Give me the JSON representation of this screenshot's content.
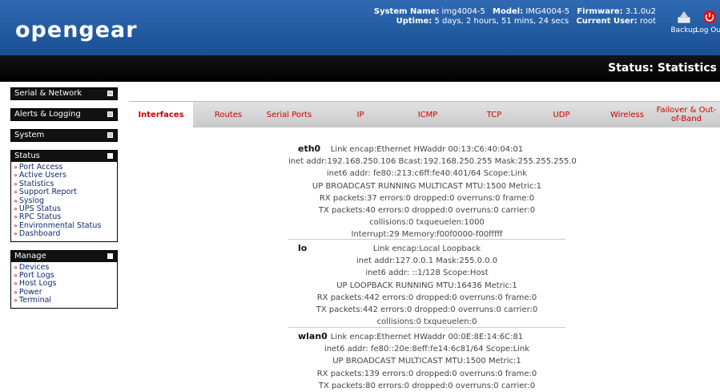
{
  "header": {
    "logo": "opengear",
    "system_name_label": "System Name:",
    "system_name": "img4004-5",
    "model_label": "Model:",
    "model": "IMG4004-5",
    "firmware_label": "Firmware:",
    "firmware": "3.1.0u2",
    "uptime_label": "Uptime:",
    "uptime": "5 days, 2 hours, 51 mins, 24 secs",
    "current_user_label": "Current User:",
    "current_user": "root",
    "backup_label": "Backup",
    "logout_label": "Log Out"
  },
  "page_title": "Status: Statistics",
  "sidebar": {
    "serial_network": "Serial & Network",
    "alerts_logging": "Alerts & Logging",
    "system": "System",
    "status": {
      "title": "Status",
      "items": [
        "Port Access",
        "Active Users",
        "Statistics",
        "Support Report",
        "Syslog",
        "UPS Status",
        "RPC Status",
        "Environmental Status",
        "Dashboard"
      ]
    },
    "manage": {
      "title": "Manage",
      "items": [
        "Devices",
        "Port Logs",
        "Host Logs",
        "Power",
        "Terminal"
      ]
    }
  },
  "tabs": [
    "Interfaces",
    "Routes",
    "Serial Ports",
    "IP",
    "ICMP",
    "TCP",
    "UDP",
    "Wireless",
    "Failover & Out-of-Band"
  ],
  "interfaces": [
    {
      "name": "eth0",
      "lines": [
        "Link encap:Ethernet HWaddr 00:13:C6:40:04:01",
        "inet addr:192.168.250.106 Bcast:192.168.250.255 Mask:255.255.255.0",
        "inet6 addr: fe80::213:c6ff:fe40:401/64 Scope:Link",
        "UP BROADCAST RUNNING MULTICAST MTU:1500 Metric:1",
        "RX packets:37 errors:0 dropped:0 overruns:0 frame:0",
        "TX packets:40 errors:0 dropped:0 overruns:0 carrier:0",
        "collisions:0 txqueuelen:1000",
        "Interrupt:29 Memory:f00f0000-f00fffff"
      ]
    },
    {
      "name": "lo",
      "lines": [
        "Link encap:Local Loopback",
        "inet addr:127.0.0.1 Mask:255.0.0.0",
        "inet6 addr: ::1/128 Scope:Host",
        "UP LOOPBACK RUNNING MTU:16436 Metric:1",
        "RX packets:442 errors:0 dropped:0 overruns:0 frame:0",
        "TX packets:442 errors:0 dropped:0 overruns:0 carrier:0",
        "collisions:0 txqueuelen:0"
      ]
    },
    {
      "name": "wlan0",
      "lines": [
        "Link encap:Ethernet HWaddr 00:0E:8E:14:6C:81",
        "inet6 addr: fe80::20e:8eff:fe14:6c81/64 Scope:Link",
        "UP BROADCAST MULTICAST MTU:1500 Metric:1",
        "RX packets:139 errors:0 dropped:0 overruns:0 frame:0",
        "TX packets:80 errors:0 dropped:0 overruns:0 carrier:0"
      ]
    }
  ],
  "colors": {
    "header": "#1f5aa5",
    "tab_text": "#cc0000",
    "link": "#102a6f"
  }
}
